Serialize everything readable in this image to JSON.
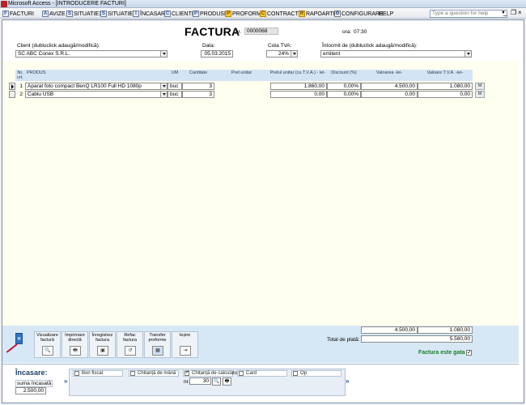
{
  "window": {
    "title": "Microsoft Access - [INTRODUCERE FACTURI]"
  },
  "menu": {
    "items": [
      {
        "label": "FACTURI",
        "icon": "F"
      },
      {
        "label": "AVIZE",
        "icon": "A"
      },
      {
        "label": "SITUATIE1",
        "icon": "S"
      },
      {
        "label": "SITUATIE2",
        "icon": "S"
      },
      {
        "label": "ÎNCASARI",
        "icon": "I"
      },
      {
        "label": "CLIENTI",
        "icon": "C"
      },
      {
        "label": "PRODUSE",
        "icon": "P"
      },
      {
        "label": "PROFORME",
        "icon": "P"
      },
      {
        "label": "CONTRACTE",
        "icon": "C"
      },
      {
        "label": "RAPOARTE",
        "icon": "R"
      },
      {
        "label": "CONFIGURARE",
        "icon": "⚙"
      },
      {
        "label": "HELP",
        "icon": ""
      }
    ],
    "help_placeholder": "Type a question for help",
    "min": "_",
    "restore": "❐",
    "close": "×"
  },
  "header": {
    "title": "FACTURA",
    "nr_label": "nr.",
    "nr_value": "0000068",
    "ora_label": "ora:",
    "ora_value": "07:30",
    "client_label": "Client (dubluclick adaugă/modifică):",
    "client_value": "SC ABC Conex S.R.L.",
    "data_label": "Data:",
    "data_value": "05.03.2015",
    "cota_label": "Cota TVA:",
    "cota_value": "24%",
    "intocmit_label": "Întocmit de (dubluclick adaugă/modifică):",
    "intocmit_value": "emitent"
  },
  "table": {
    "headers": {
      "nr": "Nr. crt.",
      "produs": "PRODUS",
      "um": "UM",
      "cantitate": "Cantitate",
      "pret": "Pret unitar",
      "pret_tva": "Pretul unitar (cu T.V.A.) - lei-",
      "discount": "Discount (%)",
      "valoarea": "Valoarea -lei-",
      "valoare_tva": "Valoare T.V.A. -lei-"
    },
    "rows": [
      {
        "nr": "1",
        "produs": "Aparat foto compact BenQ LR100 Full HD 1080p",
        "um": "buc",
        "cantitate": "3",
        "pret_tva": "1.860,00",
        "discount": "0,00%",
        "valoarea": "4.500,00",
        "valoare_tva": "1.080,00",
        "btn": "M"
      },
      {
        "nr": "2",
        "produs": "Cablu USB",
        "um": "buc",
        "cantitate": "3",
        "pret_tva": "0,00",
        "discount": "0,00%",
        "valoarea": "0,00",
        "valoare_tva": "0,00",
        "btn": "M"
      }
    ]
  },
  "toolbar": {
    "nav": "»",
    "vizualizare": "Vizualizare factură",
    "imprimare": "Imprimare directă",
    "inregistrez": "Înregistrez factura",
    "refac": "Refac factura",
    "transfer": "Transfer proforme",
    "iesire": "Ieșire"
  },
  "totals": {
    "valoarea": "4.500,00",
    "tva": "1.080,00",
    "total_label": "Total de plată:",
    "total_value": "5.580,00",
    "gata_label": "Factura este gata",
    "gata_checked": true
  },
  "incasare": {
    "title": "Încasare:",
    "suma_label": "suma încasată",
    "suma_value": "2.500,00",
    "options": [
      {
        "label": "Bon fiscal",
        "checked": false
      },
      {
        "label": "Chitanță de mână",
        "checked": false
      },
      {
        "label": "Chitanță de calculator",
        "checked": true
      },
      {
        "label": "Card",
        "checked": false
      },
      {
        "label": "Op",
        "checked": false
      }
    ],
    "nr_label": "nr.",
    "nr_value": "30",
    "arrow": "»"
  }
}
